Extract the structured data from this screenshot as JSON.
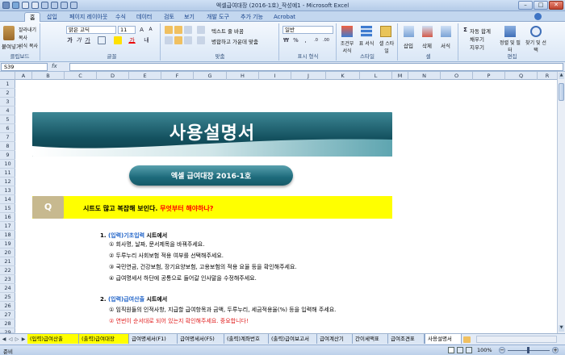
{
  "window": {
    "title": "엑셀급여대장 (2016-1호)_작성예1 - Microsoft Excel"
  },
  "tabs": [
    "홈",
    "삽입",
    "페이지 레이아웃",
    "수식",
    "데이터",
    "검토",
    "보기",
    "개발 도구",
    "추가 기능",
    "Acrobat"
  ],
  "ribbon": {
    "clipboard": {
      "paste": "붙여넣기",
      "cut": "잘라내기",
      "copy": "복사",
      "format_painter": "서식 복사",
      "label": "클립보드"
    },
    "font": {
      "name": "맑은 고딕",
      "size": "11",
      "label": "글꼴"
    },
    "alignment": {
      "wrap": "텍스트 줄 바꿈",
      "merge": "병합하고 가운데 맞춤",
      "label": "맞춤"
    },
    "number": {
      "format": "일반",
      "label": "표시 형식"
    },
    "styles": {
      "cond": "조건부 서식",
      "table": "표 서식",
      "cell": "셀 스타일",
      "label": "스타일"
    },
    "cells": {
      "insert": "삽입",
      "delete": "삭제",
      "format": "서식",
      "label": "셀"
    },
    "editing": {
      "autosum": "자동 합계",
      "fill": "채우기",
      "clear": "지우기",
      "sort": "정렬 및 필터",
      "find": "찾기 및 선택",
      "label": "편집"
    }
  },
  "formula_bar": {
    "name_box": "S39",
    "fx": "fx",
    "value": ""
  },
  "columns": [
    "A",
    "B",
    "C",
    "D",
    "E",
    "F",
    "G",
    "H",
    "I",
    "J",
    "K",
    "L",
    "M",
    "N",
    "O",
    "P",
    "Q",
    "R"
  ],
  "rows": [
    "1",
    "2",
    "3",
    "4",
    "5",
    "6",
    "7",
    "8",
    "9",
    "10",
    "11",
    "12",
    "13",
    "14",
    "15",
    "16",
    "17",
    "18",
    "19",
    "20",
    "21",
    "22",
    "23",
    "24",
    "25",
    "26",
    "27",
    "28",
    "29"
  ],
  "sheet": {
    "banner_title": "사용설명서",
    "pill_text": "엑셀  급여대장  2016-1호",
    "q_badge": "Q",
    "q_text": "시트도 많고 복잡해 보인다. ",
    "q_text_red": "무엇부터 해야하나?",
    "item1_num": "1.",
    "item1_link": "(입력)기초입력",
    "item1_rest": " 시트에서",
    "item1_lines": [
      "① 회사명, 날짜, 문서제목을 바꿔주세요.",
      "② 두루누리 사회보험 적용 여부를 선택해주세요.",
      "③ 국민연금, 건강보험, 장기요양보험, 고용보험의 적용 요율 등을 확인해주세요.",
      "④ 급여명세서 하단에 공통으로 들어갈 인사말을 수정해주세요."
    ],
    "item2_num": "2.",
    "item2_link": "(입력)급여산출",
    "item2_rest": " 시트에서",
    "item2_line1": "① 임직원들의 인적사항, 지급할 급여항목과 금액, 두루누리, 세금적용율(%) 등을 입력해 주세요.",
    "item2_line2": "② 연번이 순서대로 되어 있는지 확인해주세요. 중요합니다!"
  },
  "sheet_tabs": [
    "(입력)급여산출",
    "(출력)급여대장",
    "급여명세서(F1)",
    "급여명세서(F5)",
    "(출력)계좌번호",
    "(출력)급여보고서",
    "급여계산기",
    "간이세액표",
    "급여조견표",
    "사용설명서"
  ],
  "status": {
    "ready": "준비",
    "zoom": "100%"
  },
  "colors": {
    "banner_dark": "#13505e",
    "banner_light": "#9bcbd1",
    "question_yellow": "#ffff00",
    "q_badge": "#c7b98f",
    "link_blue": "#1f63c8",
    "warn_red": "#e01e1e"
  }
}
